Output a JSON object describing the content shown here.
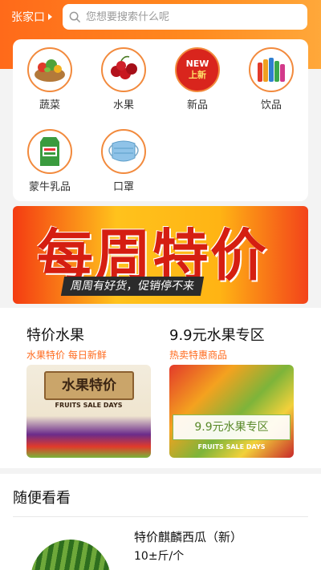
{
  "header": {
    "city": "张家口",
    "search_placeholder": "您想要搜索什么呢",
    "accent": "#ff7a1f"
  },
  "categories": [
    {
      "label": "蔬菜",
      "icon": "vegetables-basket-icon"
    },
    {
      "label": "水果",
      "icon": "cherries-icon"
    },
    {
      "label": "新品",
      "icon": "new-badge-icon",
      "badge_top": "NEW",
      "badge_bottom": "上新"
    },
    {
      "label": "饮品",
      "icon": "drinks-icon"
    },
    {
      "label": "蒙牛乳品",
      "icon": "milk-carton-icon"
    },
    {
      "label": "口罩",
      "icon": "face-mask-icon"
    }
  ],
  "banner": {
    "title": "每周特价",
    "subtitle": "周周有好货，促销停不来"
  },
  "special": [
    {
      "title": "特价水果",
      "subtitle": "水果特价  每日新鲜",
      "img_title": "水果特价",
      "img_sub": "FRUITS SALE DAYS"
    },
    {
      "title": "9.9元水果专区",
      "subtitle": "热卖特惠商品",
      "img_title": "9.9元水果专区",
      "img_sub": "FRUITS SALE DAYS"
    }
  ],
  "random": {
    "heading": "随便看看",
    "product_name": "特价麒麟西瓜（新）",
    "product_unit": "10±斤/个"
  }
}
